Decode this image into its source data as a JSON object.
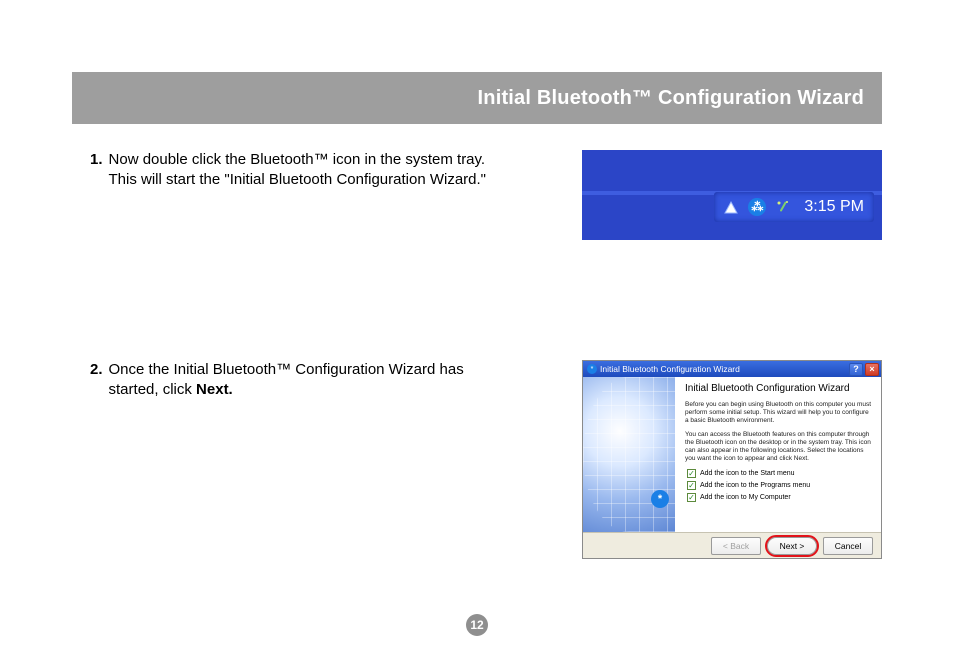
{
  "page_title": "Initial Bluetooth™ Configuration Wizard",
  "page_number": "12",
  "steps": [
    {
      "num": "1.",
      "text": "Now double click the Bluetooth™  icon in the system tray. This will start the \"Initial Bluetooth Configuration Wizard.\""
    },
    {
      "num": "2.",
      "text_prefix": "Once the Initial Bluetooth™ Configuration Wizard has started, click ",
      "text_bold": "Next."
    }
  ],
  "systray": {
    "time": "3:15 PM",
    "icons": {
      "triangle": "network-status-icon",
      "bluetooth": "bluetooth-icon",
      "wand": "wand-icon"
    }
  },
  "wizard": {
    "title": "Initial Bluetooth Configuration Wizard",
    "heading": "Initial Bluetooth Configuration Wizard",
    "para1": "Before you can begin using Bluetooth on this computer you must perform some initial setup. This wizard will help you to configure a basic Bluetooth environment.",
    "para2": "You can access the Bluetooth features on this computer through the Bluetooth icon on the desktop or in the system tray. This icon can also appear in the following locations. Select the locations you want the icon to appear and click Next.",
    "checks": [
      "Add the icon to the Start menu",
      "Add the icon to the Programs menu",
      "Add the icon to My Computer"
    ],
    "buttons": {
      "back": "< Back",
      "next": "Next >",
      "cancel": "Cancel"
    }
  }
}
